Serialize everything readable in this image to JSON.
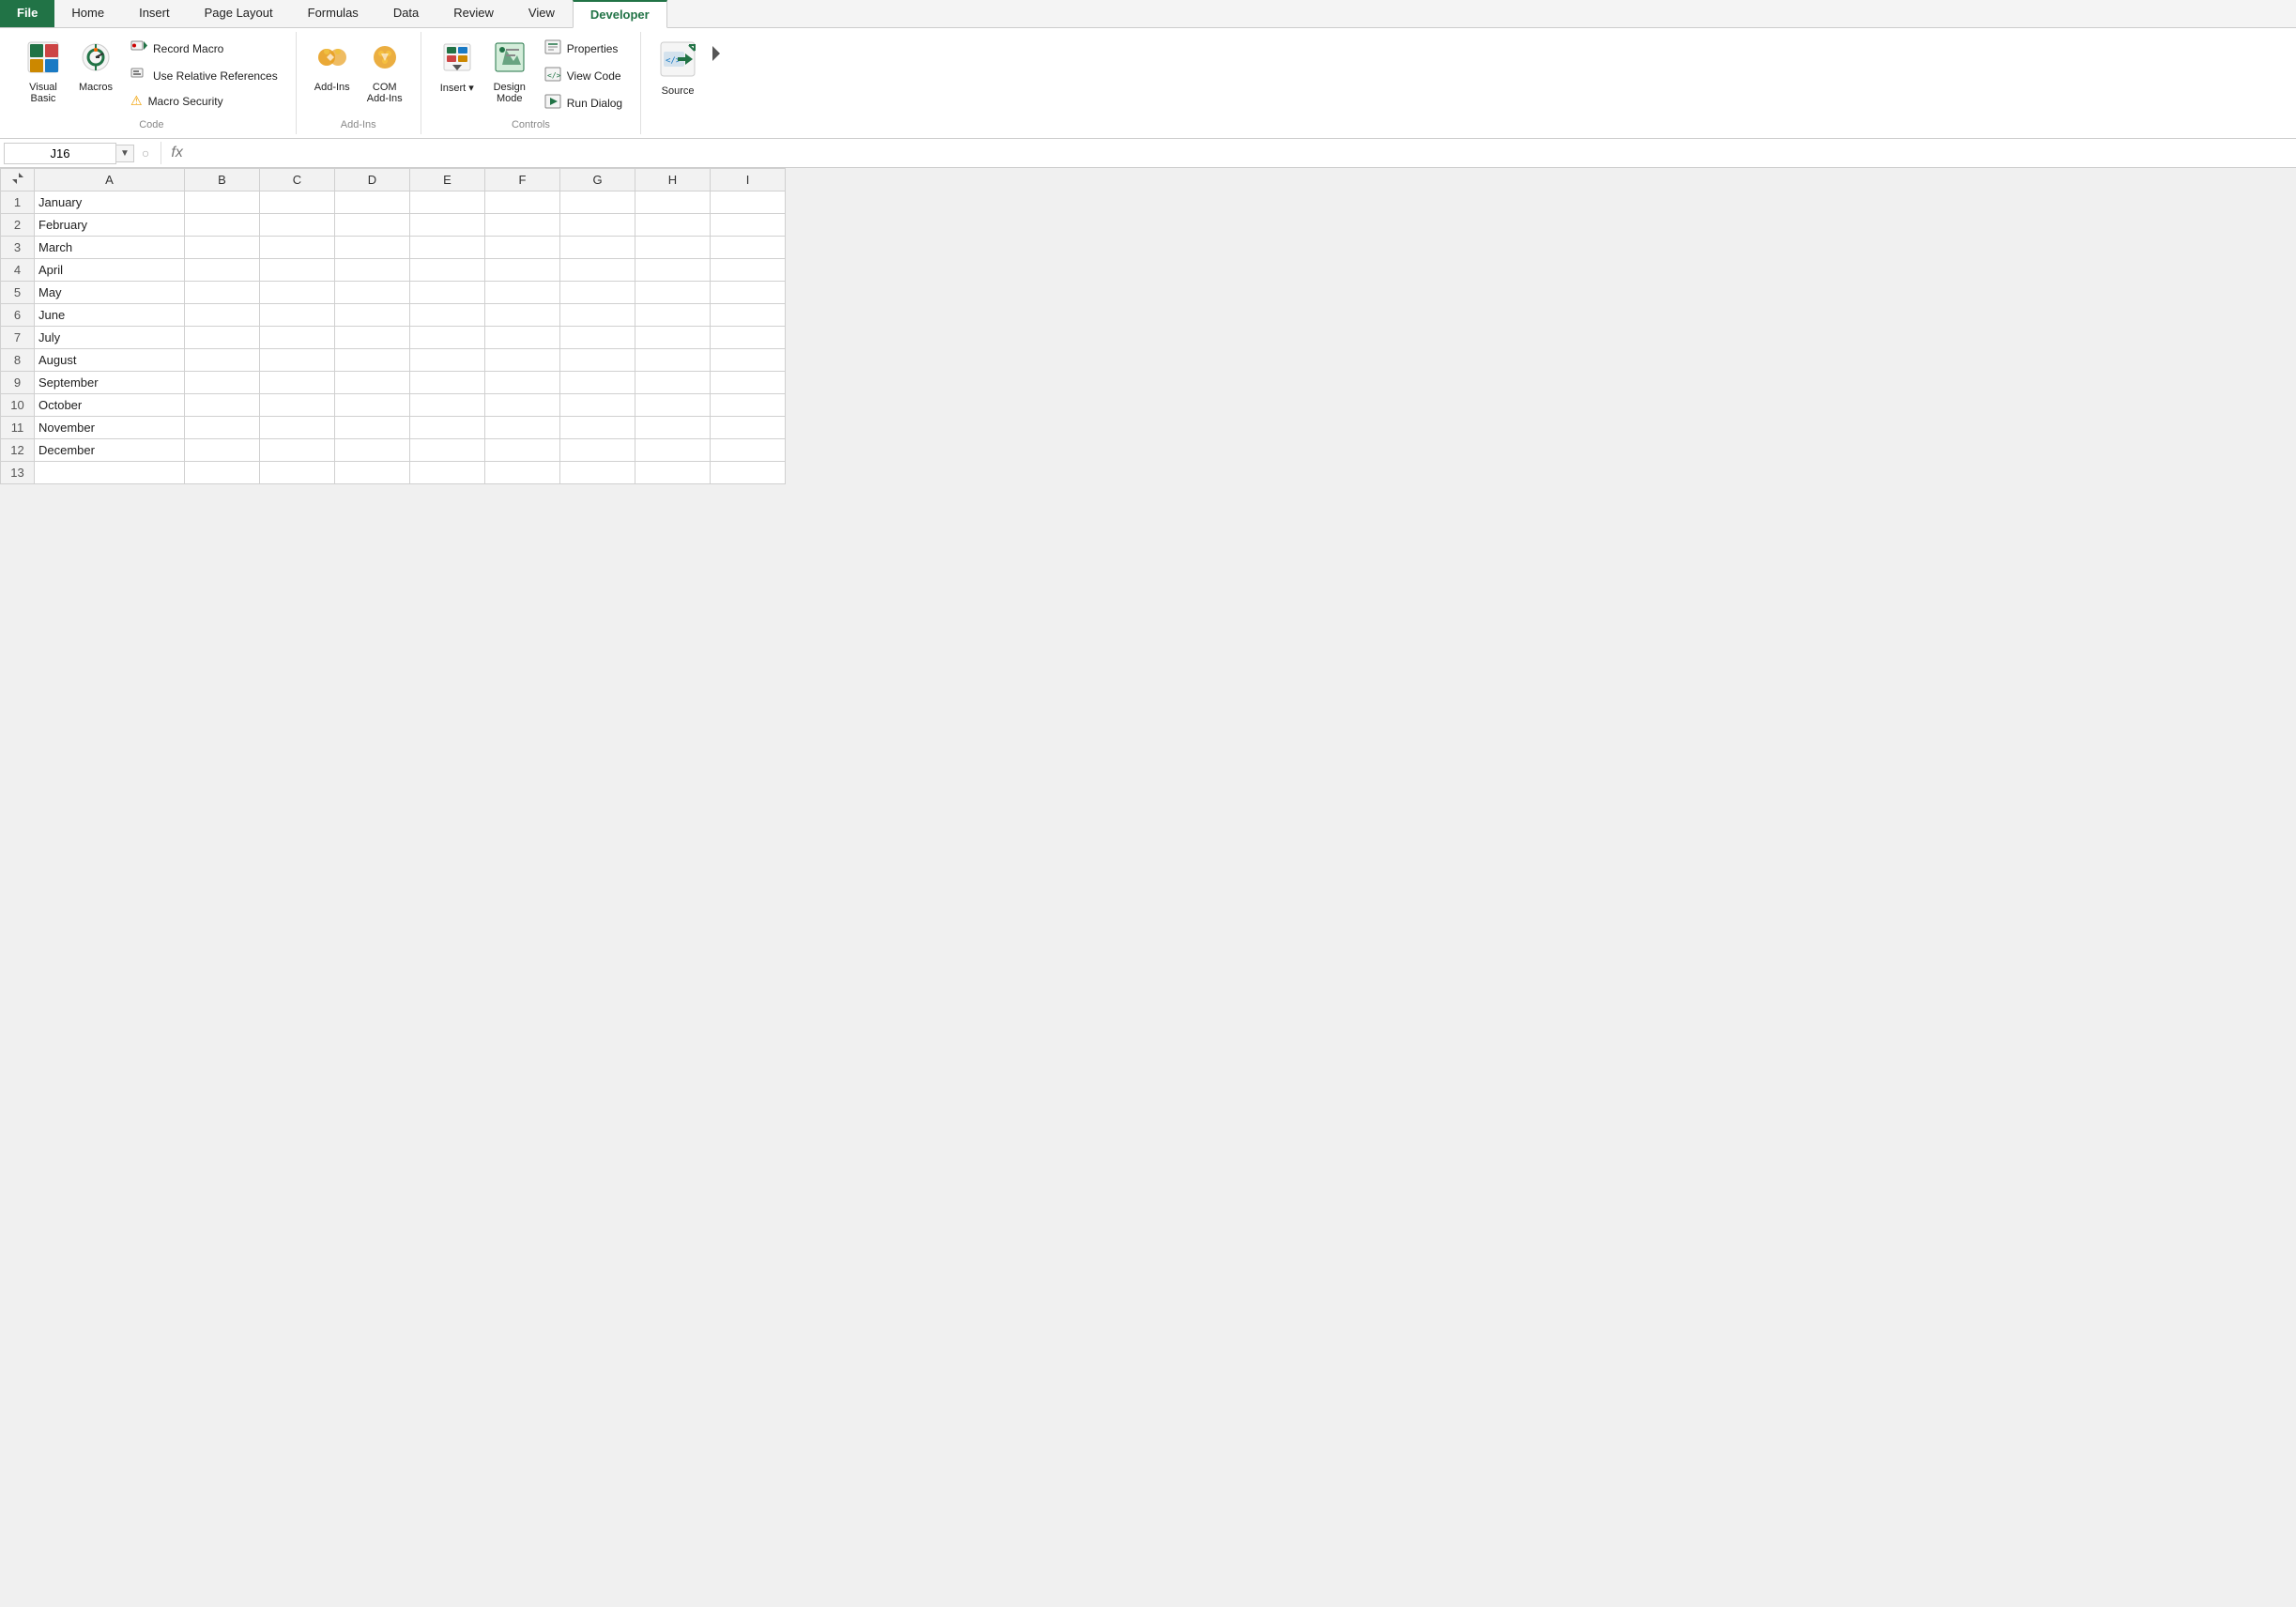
{
  "tabs": [
    {
      "label": "File",
      "id": "file",
      "active": false
    },
    {
      "label": "Home",
      "id": "home",
      "active": false
    },
    {
      "label": "Insert",
      "id": "insert",
      "active": false
    },
    {
      "label": "Page Layout",
      "id": "page-layout",
      "active": false
    },
    {
      "label": "Formulas",
      "id": "formulas",
      "active": false
    },
    {
      "label": "Data",
      "id": "data",
      "active": false
    },
    {
      "label": "Review",
      "id": "review",
      "active": false
    },
    {
      "label": "View",
      "id": "view",
      "active": false
    },
    {
      "label": "Developer",
      "id": "developer",
      "active": true
    }
  ],
  "ribbon": {
    "groups": [
      {
        "id": "code",
        "label": "Code",
        "items": [
          {
            "type": "large",
            "id": "visual-basic",
            "label": "Visual\nBasic",
            "icon": "🔷"
          },
          {
            "type": "large",
            "id": "macros",
            "label": "Macros",
            "icon": "⚙"
          },
          {
            "type": "stack",
            "items": [
              {
                "type": "small",
                "id": "record-macro",
                "label": "Record Macro",
                "icon": "🔴"
              },
              {
                "type": "small",
                "id": "use-relative",
                "label": "Use Relative References",
                "icon": "📋"
              },
              {
                "type": "small",
                "id": "macro-security",
                "label": "Macro Security",
                "icon": "⚠"
              }
            ]
          }
        ]
      },
      {
        "id": "addins",
        "label": "Add-Ins",
        "items": [
          {
            "type": "large",
            "id": "add-ins",
            "label": "Add-Ins",
            "icon": "⚙"
          },
          {
            "type": "large",
            "id": "com-add-ins",
            "label": "COM\nAdd-Ins",
            "icon": "⚙"
          }
        ]
      },
      {
        "id": "controls",
        "label": "Controls",
        "items": [
          {
            "type": "large",
            "id": "insert-control",
            "label": "Insert",
            "icon": "🔨"
          },
          {
            "type": "large",
            "id": "design-mode",
            "label": "Design\nMode",
            "icon": "📐"
          },
          {
            "type": "stack",
            "items": [
              {
                "type": "small",
                "id": "properties",
                "label": "Properties",
                "icon": "📋"
              },
              {
                "type": "small",
                "id": "view-code",
                "label": "View Code",
                "icon": "📄"
              },
              {
                "type": "small",
                "id": "run-dialog",
                "label": "Run Dialog",
                "icon": "▶"
              }
            ]
          }
        ]
      },
      {
        "id": "xml",
        "label": "",
        "items": [
          {
            "type": "large",
            "id": "source",
            "label": "Source",
            "icon": "🔀"
          }
        ]
      }
    ]
  },
  "formula_bar": {
    "name_box": "J16",
    "formula_icon": "fx"
  },
  "columns": [
    "A",
    "B",
    "C",
    "D",
    "E",
    "F",
    "G",
    "H",
    "I"
  ],
  "rows": [
    {
      "num": 1,
      "cells": [
        "January",
        "",
        "",
        "",
        "",
        "",
        "",
        "",
        ""
      ]
    },
    {
      "num": 2,
      "cells": [
        "February",
        "",
        "",
        "",
        "",
        "",
        "",
        "",
        ""
      ]
    },
    {
      "num": 3,
      "cells": [
        "March",
        "",
        "",
        "",
        "",
        "",
        "",
        "",
        ""
      ]
    },
    {
      "num": 4,
      "cells": [
        "April",
        "",
        "",
        "",
        "",
        "",
        "",
        "",
        ""
      ]
    },
    {
      "num": 5,
      "cells": [
        "May",
        "",
        "",
        "",
        "",
        "",
        "",
        "",
        ""
      ]
    },
    {
      "num": 6,
      "cells": [
        "June",
        "",
        "",
        "",
        "",
        "",
        "",
        "",
        ""
      ]
    },
    {
      "num": 7,
      "cells": [
        "July",
        "",
        "",
        "",
        "",
        "",
        "",
        "",
        ""
      ]
    },
    {
      "num": 8,
      "cells": [
        "August",
        "",
        "",
        "",
        "",
        "",
        "",
        "",
        ""
      ]
    },
    {
      "num": 9,
      "cells": [
        "September",
        "",
        "",
        "",
        "",
        "",
        "",
        "",
        ""
      ]
    },
    {
      "num": 10,
      "cells": [
        "October",
        "",
        "",
        "",
        "",
        "",
        "",
        "",
        ""
      ]
    },
    {
      "num": 11,
      "cells": [
        "November",
        "",
        "",
        "",
        "",
        "",
        "",
        "",
        ""
      ]
    },
    {
      "num": 12,
      "cells": [
        "December",
        "",
        "",
        "",
        "",
        "",
        "",
        "",
        ""
      ]
    },
    {
      "num": 13,
      "cells": [
        "",
        "",
        "",
        "",
        "",
        "",
        "",
        "",
        ""
      ]
    }
  ]
}
